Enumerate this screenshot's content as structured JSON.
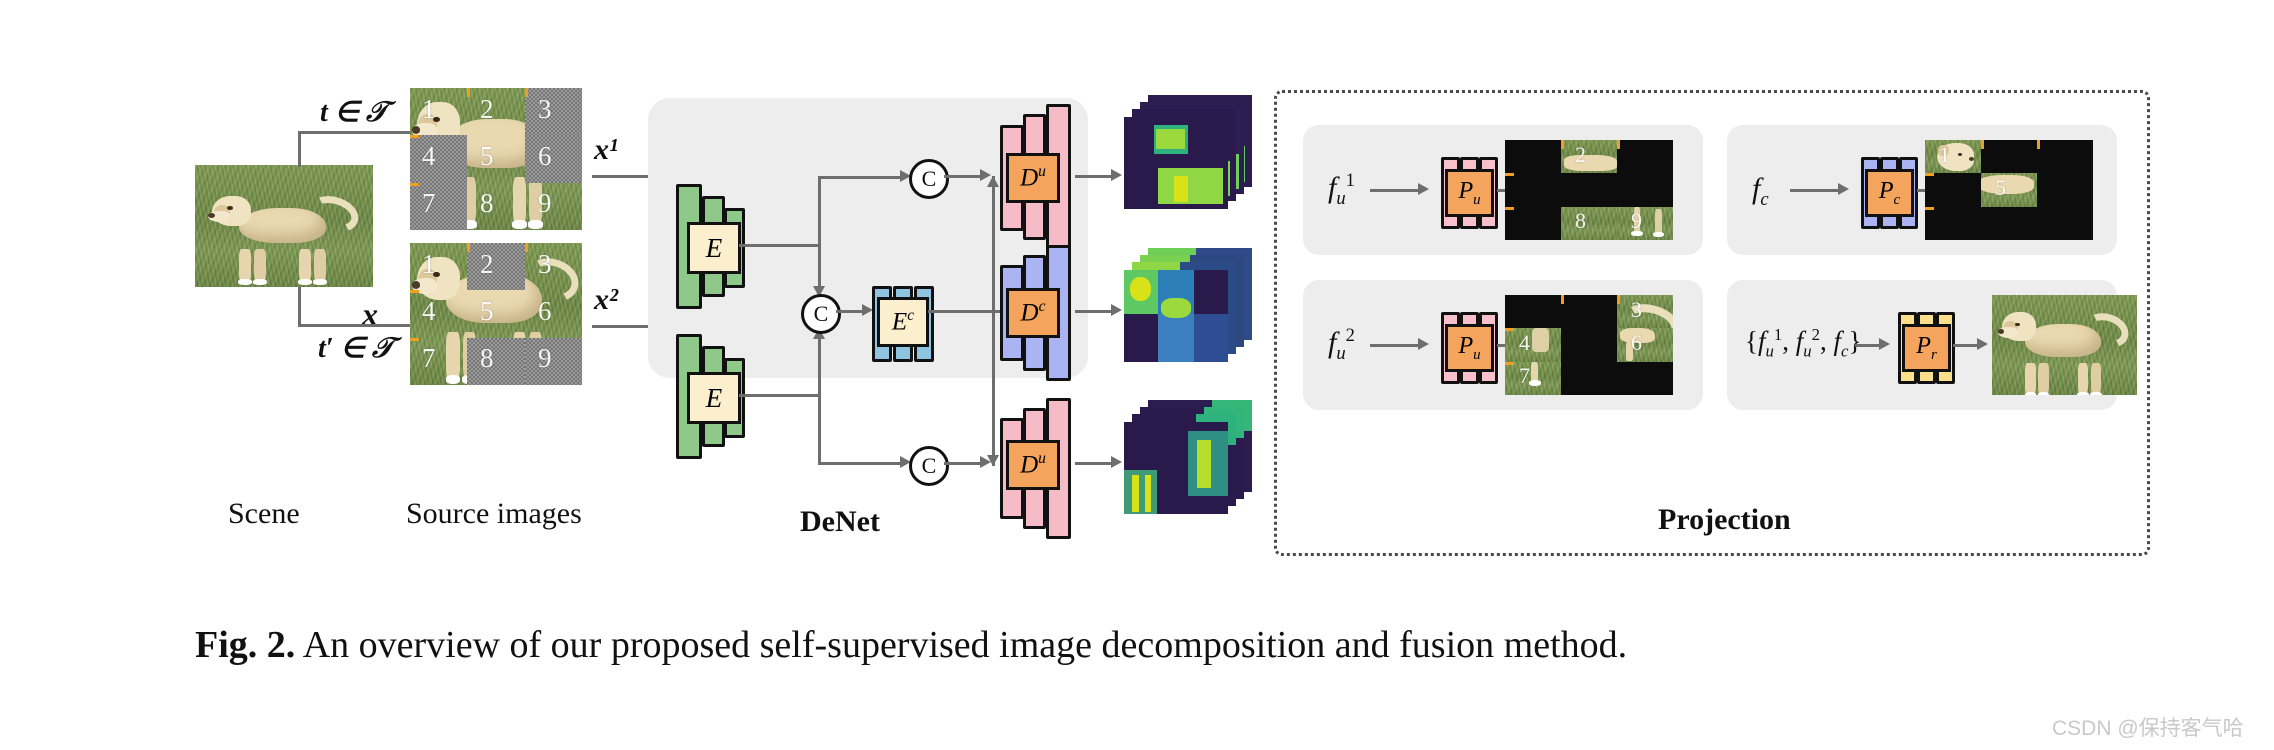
{
  "figure": {
    "caption_label": "Fig. 2.",
    "caption_text": "An overview of our proposed self-supervised image decomposition and fusion method."
  },
  "watermark": "CSDN @保持客气哈",
  "left": {
    "scene_label": "Scene",
    "source_label": "Source images",
    "transform_top": "t ∈ 𝒯",
    "transform_bottom": "t′ ∈ 𝒯",
    "scene_symbol": "x",
    "source1_symbol": "x¹",
    "source2_symbol": "x²",
    "patch_numbers": [
      "1",
      "2",
      "3",
      "4",
      "5",
      "6",
      "7",
      "8",
      "9"
    ]
  },
  "denet": {
    "title": "DeNet",
    "encoder_top_label": "E",
    "encoder_bottom_label": "E",
    "common_encoder_label": "E",
    "common_encoder_sup": "c",
    "decoder_top_label": "D",
    "decoder_top_sup": "u",
    "decoder_mid_label": "D",
    "decoder_mid_sup": "c",
    "decoder_bottom_label": "D",
    "decoder_bottom_sup": "u",
    "concat_symbol": "C",
    "outputs": [
      {
        "name": "f",
        "sub": "u",
        "sup": "1"
      },
      {
        "name": "f",
        "sub": "c",
        "sup": ""
      },
      {
        "name": "f",
        "sub": "u",
        "sup": "2"
      }
    ]
  },
  "projection": {
    "title": "Projection",
    "cells": [
      {
        "input": "f_u^1",
        "input_base": "f",
        "input_sub": "u",
        "input_sup": "1",
        "block_base": "P",
        "block_sub": "u",
        "visible_patches": [
          "2",
          "8",
          "9"
        ]
      },
      {
        "input": "f_c",
        "input_base": "f",
        "input_sub": "c",
        "input_sup": "",
        "block_base": "P",
        "block_sub": "c",
        "visible_patches": [
          "1",
          "5"
        ]
      },
      {
        "input": "f_u^2",
        "input_base": "f",
        "input_sub": "u",
        "input_sup": "2",
        "block_base": "P",
        "block_sub": "u",
        "visible_patches": [
          "3",
          "4",
          "6",
          "7"
        ]
      },
      {
        "input": "{f_u^1, f_u^2, f_c}",
        "input_base": "",
        "input_sub": "",
        "input_sup": "",
        "block_base": "P",
        "block_sub": "r",
        "visible_patches": []
      }
    ]
  },
  "colors": {
    "encoder_green": "#8fc98a",
    "common_blue": "#8fc4e0",
    "decoder_pink": "#f5bcc8",
    "decoder_periwinkle": "#aab4f2",
    "core_orange": "#f5a45d",
    "core_cream": "#fbefcd",
    "proj_pink": "#f7c0cb",
    "proj_blue": "#aab4f2",
    "proj_yellow": "#fbdf8a",
    "panel_grey": "#ededed",
    "grid_orange": "#f0a020",
    "arrow_grey": "#6e6e6e"
  }
}
